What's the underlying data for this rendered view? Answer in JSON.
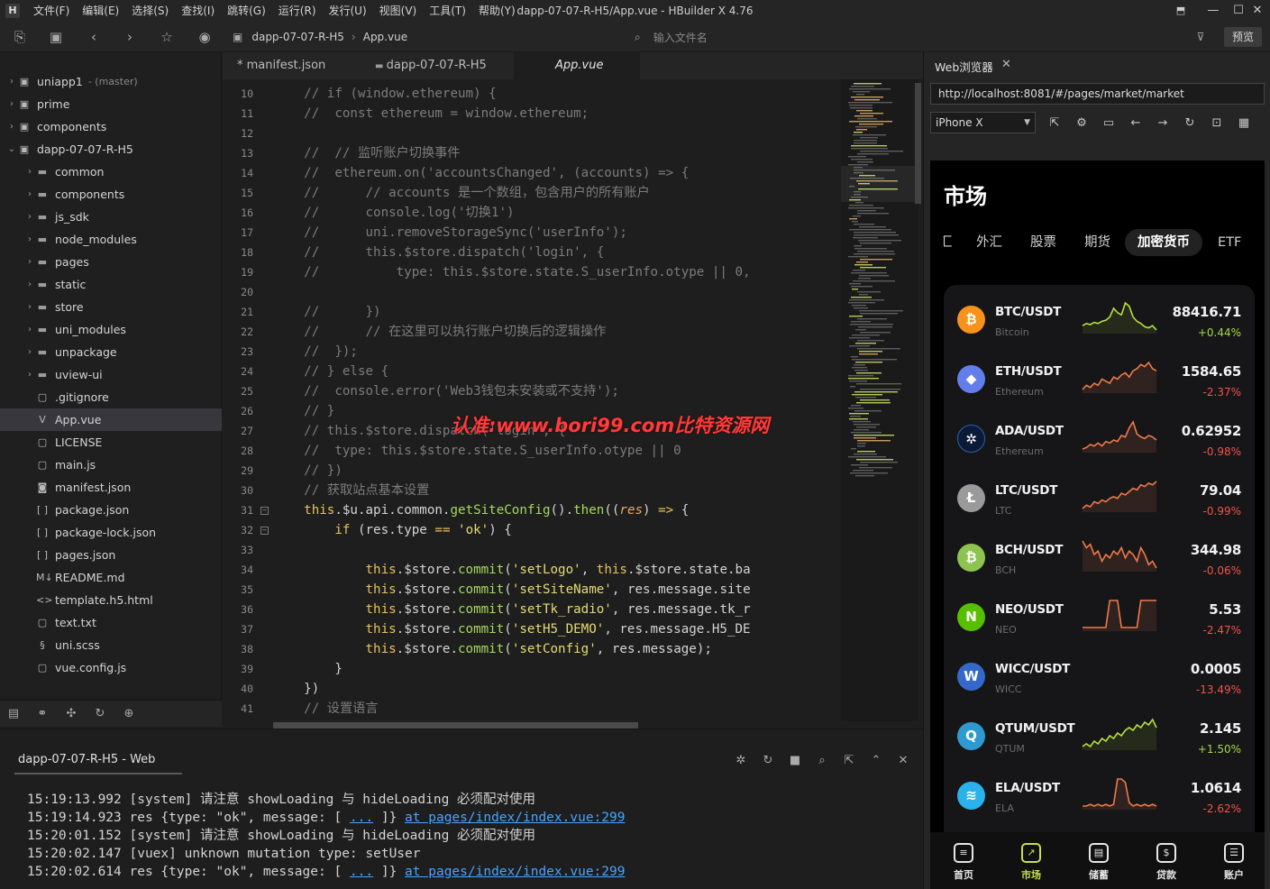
{
  "window": {
    "title": "dapp-07-07-R-H5/App.vue - HBuilder X 4.76"
  },
  "menu": [
    "文件(F)",
    "编辑(E)",
    "选择(S)",
    "查找(I)",
    "跳转(G)",
    "运行(R)",
    "发行(U)",
    "视图(V)",
    "工具(T)",
    "帮助(Y)"
  ],
  "toolbar": {
    "crumb_project": "dapp-07-07-R-H5",
    "crumb_file": "App.vue",
    "file_search_placeholder": "输入文件名",
    "preview_label": "预览"
  },
  "sidebar": {
    "items": [
      {
        "label": "uniapp1",
        "sub": "(master)",
        "indent": 0,
        "type": "project",
        "chevron": "›"
      },
      {
        "label": "prime",
        "sub": "",
        "indent": 0,
        "type": "project",
        "chevron": "›"
      },
      {
        "label": "components",
        "sub": "",
        "indent": 0,
        "type": "project",
        "chevron": "›"
      },
      {
        "label": "dapp-07-07-R-H5",
        "sub": "",
        "indent": 0,
        "type": "project",
        "chevron": "⌄"
      },
      {
        "label": "common",
        "sub": "",
        "indent": 1,
        "type": "folder",
        "chevron": "›"
      },
      {
        "label": "components",
        "sub": "",
        "indent": 1,
        "type": "folder",
        "chevron": "›"
      },
      {
        "label": "js_sdk",
        "sub": "",
        "indent": 1,
        "type": "folder",
        "chevron": "›"
      },
      {
        "label": "node_modules",
        "sub": "",
        "indent": 1,
        "type": "folder",
        "chevron": "›"
      },
      {
        "label": "pages",
        "sub": "",
        "indent": 1,
        "type": "folder",
        "chevron": "›"
      },
      {
        "label": "static",
        "sub": "",
        "indent": 1,
        "type": "folder",
        "chevron": "›"
      },
      {
        "label": "store",
        "sub": "",
        "indent": 1,
        "type": "folder",
        "chevron": "›"
      },
      {
        "label": "uni_modules",
        "sub": "",
        "indent": 1,
        "type": "folder",
        "chevron": "›"
      },
      {
        "label": "unpackage",
        "sub": "",
        "indent": 1,
        "type": "folder",
        "chevron": "›"
      },
      {
        "label": "uview-ui",
        "sub": "",
        "indent": 1,
        "type": "folder",
        "chevron": "›"
      },
      {
        "label": ".gitignore",
        "sub": "",
        "indent": 1,
        "type": "file",
        "chevron": ""
      },
      {
        "label": "App.vue",
        "sub": "",
        "indent": 1,
        "type": "vue",
        "chevron": "",
        "selected": true
      },
      {
        "label": "LICENSE",
        "sub": "",
        "indent": 1,
        "type": "file",
        "chevron": ""
      },
      {
        "label": "main.js",
        "sub": "",
        "indent": 1,
        "type": "js",
        "chevron": ""
      },
      {
        "label": "manifest.json",
        "sub": "",
        "indent": 1,
        "type": "manifest",
        "chevron": ""
      },
      {
        "label": "package.json",
        "sub": "",
        "indent": 1,
        "type": "json",
        "chevron": ""
      },
      {
        "label": "package-lock.json",
        "sub": "",
        "indent": 1,
        "type": "json",
        "chevron": ""
      },
      {
        "label": "pages.json",
        "sub": "",
        "indent": 1,
        "type": "json",
        "chevron": ""
      },
      {
        "label": "README.md",
        "sub": "",
        "indent": 1,
        "type": "md",
        "chevron": ""
      },
      {
        "label": "template.h5.html",
        "sub": "",
        "indent": 1,
        "type": "html",
        "chevron": ""
      },
      {
        "label": "text.txt",
        "sub": "",
        "indent": 1,
        "type": "file",
        "chevron": ""
      },
      {
        "label": "uni.scss",
        "sub": "",
        "indent": 1,
        "type": "scss",
        "chevron": ""
      },
      {
        "label": "vue.config.js",
        "sub": "",
        "indent": 1,
        "type": "js",
        "chevron": ""
      }
    ]
  },
  "tabs": [
    {
      "label": "* manifest.json",
      "active": false
    },
    {
      "label": "dapp-07-07-R-H5",
      "active": false
    },
    {
      "label": "App.vue",
      "active": true
    }
  ],
  "code_lines": [
    {
      "n": "10",
      "fold": "",
      "parts": [
        [
          "cm",
          "    // if (window.ethereum) {"
        ]
      ]
    },
    {
      "n": "11",
      "fold": "",
      "parts": [
        [
          "cm",
          "    //  const ethereum = window.ethereum;"
        ]
      ]
    },
    {
      "n": "12",
      "fold": "",
      "parts": [
        [
          "cm",
          ""
        ]
      ]
    },
    {
      "n": "13",
      "fold": "",
      "parts": [
        [
          "cm",
          "    //  // 监听账户切换事件"
        ]
      ]
    },
    {
      "n": "14",
      "fold": "",
      "parts": [
        [
          "cm",
          "    //  ethereum.on('accountsChanged', (accounts) => {"
        ]
      ]
    },
    {
      "n": "15",
      "fold": "",
      "parts": [
        [
          "cm",
          "    //      // accounts 是一个数组，包含用户的所有账户"
        ]
      ]
    },
    {
      "n": "16",
      "fold": "",
      "parts": [
        [
          "cm",
          "    //      console.log('切换1')"
        ]
      ]
    },
    {
      "n": "17",
      "fold": "",
      "parts": [
        [
          "cm",
          "    //      uni.removeStorageSync('userInfo');"
        ]
      ]
    },
    {
      "n": "18",
      "fold": "",
      "parts": [
        [
          "cm",
          "    //      this.$store.dispatch('login', {"
        ]
      ]
    },
    {
      "n": "19",
      "fold": "",
      "parts": [
        [
          "cm",
          "    //          type: this.$store.state.S_userInfo.otype || 0,"
        ]
      ]
    },
    {
      "n": "20",
      "fold": "",
      "parts": [
        [
          "cm",
          ""
        ]
      ]
    },
    {
      "n": "21",
      "fold": "",
      "parts": [
        [
          "cm",
          "    //      })"
        ]
      ]
    },
    {
      "n": "22",
      "fold": "",
      "parts": [
        [
          "cm",
          "    //      // 在这里可以执行账户切换后的逻辑操作"
        ]
      ]
    },
    {
      "n": "23",
      "fold": "",
      "parts": [
        [
          "cm",
          "    //  });"
        ]
      ]
    },
    {
      "n": "24",
      "fold": "",
      "parts": [
        [
          "cm",
          "    // } else {"
        ]
      ]
    },
    {
      "n": "25",
      "fold": "",
      "parts": [
        [
          "cm",
          "    //  console.error('Web3钱包未安装或不支持');"
        ]
      ]
    },
    {
      "n": "26",
      "fold": "",
      "parts": [
        [
          "cm",
          "    // }"
        ]
      ]
    },
    {
      "n": "27",
      "fold": "",
      "parts": [
        [
          "cm",
          "    // this.$store.dispatch('login', {"
        ]
      ]
    },
    {
      "n": "28",
      "fold": "",
      "parts": [
        [
          "cm",
          "    //  type: this.$store.state.S_userInfo.otype || 0"
        ]
      ]
    },
    {
      "n": "29",
      "fold": "",
      "parts": [
        [
          "cm",
          "    // })"
        ]
      ]
    },
    {
      "n": "30",
      "fold": "",
      "parts": [
        [
          "cm",
          "    // 获取站点基本设置"
        ]
      ]
    },
    {
      "n": "31",
      "fold": "⊟",
      "parts": [
        [
          "kw",
          "    this"
        ],
        [
          "pu",
          ".$u.api.common."
        ],
        [
          "fn",
          "getSiteConfig"
        ],
        [
          "pu",
          "()."
        ],
        [
          "fn",
          "then"
        ],
        [
          "pu",
          "(("
        ],
        [
          "it",
          "res"
        ],
        [
          "pu",
          ") "
        ],
        [
          "kw",
          "=>"
        ],
        [
          "pu",
          " {"
        ]
      ]
    },
    {
      "n": "32",
      "fold": "⊟",
      "parts": [
        [
          "pu",
          "        "
        ],
        [
          "kw",
          "if"
        ],
        [
          "pu",
          " (res.type "
        ],
        [
          "kw",
          "=="
        ],
        [
          "pu",
          " "
        ],
        [
          "str",
          "'ok'"
        ],
        [
          "pu",
          ") {"
        ]
      ]
    },
    {
      "n": "33",
      "fold": "",
      "parts": [
        [
          "pu",
          ""
        ]
      ]
    },
    {
      "n": "34",
      "fold": "",
      "parts": [
        [
          "kw",
          "            this"
        ],
        [
          "pu",
          ".$store."
        ],
        [
          "fn",
          "commit"
        ],
        [
          "pu",
          "("
        ],
        [
          "str",
          "'setLogo'"
        ],
        [
          "pu",
          ", "
        ],
        [
          "kw",
          "this"
        ],
        [
          "pu",
          ".$store.state.ba"
        ]
      ]
    },
    {
      "n": "35",
      "fold": "",
      "parts": [
        [
          "kw",
          "            this"
        ],
        [
          "pu",
          ".$store."
        ],
        [
          "fn",
          "commit"
        ],
        [
          "pu",
          "("
        ],
        [
          "str",
          "'setSiteName'"
        ],
        [
          "pu",
          ", res.message.site"
        ]
      ]
    },
    {
      "n": "36",
      "fold": "",
      "parts": [
        [
          "kw",
          "            this"
        ],
        [
          "pu",
          ".$store."
        ],
        [
          "fn",
          "commit"
        ],
        [
          "pu",
          "("
        ],
        [
          "str",
          "'setTk_radio'"
        ],
        [
          "pu",
          ", res.message.tk_r"
        ]
      ]
    },
    {
      "n": "37",
      "fold": "",
      "parts": [
        [
          "kw",
          "            this"
        ],
        [
          "pu",
          ".$store."
        ],
        [
          "fn",
          "commit"
        ],
        [
          "pu",
          "("
        ],
        [
          "str",
          "'setH5_DEMO'"
        ],
        [
          "pu",
          ", res.message.H5_DE"
        ]
      ]
    },
    {
      "n": "38",
      "fold": "",
      "parts": [
        [
          "kw",
          "            this"
        ],
        [
          "pu",
          ".$store."
        ],
        [
          "fn",
          "commit"
        ],
        [
          "pu",
          "("
        ],
        [
          "str",
          "'setConfig'"
        ],
        [
          "pu",
          ", res.message);"
        ]
      ]
    },
    {
      "n": "39",
      "fold": "",
      "parts": [
        [
          "pu",
          "        }"
        ]
      ]
    },
    {
      "n": "40",
      "fold": "",
      "parts": [
        [
          "pu",
          "    })"
        ]
      ]
    },
    {
      "n": "41",
      "fold": "",
      "parts": [
        [
          "cm",
          "    // 设置语言"
        ]
      ]
    }
  ],
  "watermark": "认准:www.bori99.com比特资源网",
  "console": {
    "tab_label": "dapp-07-07-R-H5 - Web",
    "lines": [
      {
        "text": "15:19:13.992 [system] 请注意 showLoading 与 hideLoading 必须配对使用",
        "link": ""
      },
      {
        "text": "15:19:14.923 res {type: \"ok\", message: [ ",
        "dots": "...",
        "mid": " ]} ",
        "link": "at pages/index/index.vue:299"
      },
      {
        "text": "15:20:01.152 [system] 请注意 showLoading 与 hideLoading 必须配对使用",
        "link": ""
      },
      {
        "text": "15:20:02.147 [vuex] unknown mutation type: setUser",
        "link": ""
      },
      {
        "text": "15:20:02.614 res {type: \"ok\", message: [ ",
        "dots": "...",
        "mid": " ]} ",
        "link": "at pages/index/index.vue:299"
      }
    ]
  },
  "web_panel": {
    "tab_label": "Web浏览器",
    "url": "http://localhost:8081/#/pages/market/market",
    "device": "iPhone X"
  },
  "phone": {
    "title": "市场",
    "tabs": [
      {
        "label": "汇",
        "active": false
      },
      {
        "label": "外汇",
        "active": false
      },
      {
        "label": "股票",
        "active": false
      },
      {
        "label": "期货",
        "active": false
      },
      {
        "label": "加密货币",
        "active": true
      },
      {
        "label": "ETF",
        "active": false
      }
    ],
    "accent": "#c5e051",
    "markets": [
      {
        "pair": "BTC/USDT",
        "name": "Bitcoin",
        "price": "88416.71",
        "change": "+0.44%",
        "dir": "up",
        "color": "#f7931a",
        "glyph": "₿",
        "spark": [
          14,
          16,
          15,
          17,
          16,
          18,
          19,
          22,
          30,
          26,
          24,
          35,
          32,
          22,
          18,
          16,
          13,
          12,
          14,
          10
        ]
      },
      {
        "pair": "ETH/USDT",
        "name": "Ethereum",
        "price": "1584.65",
        "change": "-2.37%",
        "dir": "down",
        "color": "#627eea",
        "glyph": "◆",
        "spark": [
          12,
          14,
          13,
          15,
          14,
          17,
          16,
          15,
          18,
          17,
          19,
          20,
          18,
          21,
          22,
          24,
          23,
          25,
          22,
          21
        ]
      },
      {
        "pair": "ADA/USDT",
        "name": "Ethereum",
        "price": "0.62952",
        "change": "-0.98%",
        "dir": "down",
        "color": "#0b1a36",
        "glyph": "✲",
        "spark": [
          10,
          11,
          13,
          12,
          14,
          12,
          15,
          14,
          16,
          15,
          19,
          18,
          24,
          28,
          20,
          18,
          17,
          19,
          18,
          16
        ]
      },
      {
        "pair": "LTC/USDT",
        "name": "LTC",
        "price": "79.04",
        "change": "-0.99%",
        "dir": "down",
        "color": "#9a9a9a",
        "glyph": "Ł",
        "spark": [
          8,
          10,
          9,
          12,
          11,
          13,
          12,
          14,
          15,
          14,
          17,
          16,
          18,
          20,
          19,
          22,
          21,
          23,
          22,
          24
        ]
      },
      {
        "pair": "BCH/USDT",
        "name": "BCH",
        "price": "344.98",
        "change": "-0.06%",
        "dir": "down",
        "color": "#8dc351",
        "glyph": "₿",
        "spark": [
          26,
          24,
          25,
          22,
          23,
          20,
          22,
          21,
          23,
          22,
          24,
          21,
          23,
          22,
          20,
          24,
          22,
          19,
          20,
          18
        ]
      },
      {
        "pair": "NEO/USDT",
        "name": "NEO",
        "price": "5.53",
        "change": "-2.47%",
        "dir": "down",
        "color": "#58bf00",
        "glyph": "N",
        "spark": [
          6,
          6,
          6,
          6,
          6,
          6,
          6,
          32,
          32,
          32,
          6,
          6,
          6,
          6,
          6,
          32,
          32,
          32,
          32,
          32
        ]
      },
      {
        "pair": "WICC/USDT",
        "name": "WICC",
        "price": "0.0005",
        "change": "-13.49%",
        "dir": "down",
        "color": "#3468c9",
        "glyph": "W",
        "spark": []
      },
      {
        "pair": "QTUM/USDT",
        "name": "QTUM",
        "price": "2.145",
        "change": "+1.50%",
        "dir": "up",
        "color": "#2e9ad0",
        "glyph": "Q",
        "spark": [
          14,
          15,
          14,
          16,
          15,
          17,
          16,
          18,
          17,
          19,
          18,
          20,
          21,
          20,
          22,
          21,
          23,
          22,
          24,
          21
        ]
      },
      {
        "pair": "ELA/USDT",
        "name": "ELA",
        "price": "1.0614",
        "change": "-2.62%",
        "dir": "down",
        "color": "#29b3ea",
        "glyph": "≋",
        "spark": [
          8,
          8,
          9,
          8,
          9,
          8,
          9,
          8,
          9,
          24,
          24,
          22,
          10,
          8,
          9,
          8,
          9,
          8,
          9,
          8
        ]
      }
    ],
    "nav": [
      {
        "label": "首页",
        "glyph": "≡",
        "active": false
      },
      {
        "label": "市场",
        "glyph": "↗",
        "active": true
      },
      {
        "label": "储蓄",
        "glyph": "▤",
        "active": false
      },
      {
        "label": "贷款",
        "glyph": "$",
        "active": false
      },
      {
        "label": "账户",
        "glyph": "☰",
        "active": false
      }
    ]
  }
}
